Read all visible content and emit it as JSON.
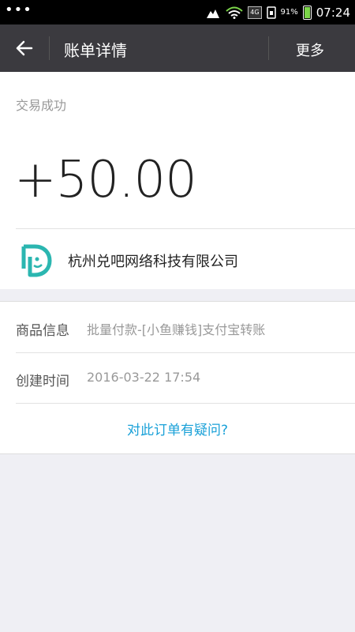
{
  "status_bar": {
    "time": "07:24",
    "battery_pct": "91%",
    "network": "4G"
  },
  "header": {
    "title": "账单详情",
    "more_label": "更多"
  },
  "transaction": {
    "status": "交易成功",
    "amount": "+50.00",
    "merchant": "杭州兑吧网络科技有限公司"
  },
  "details": [
    {
      "label": "商品信息",
      "value": "批量付款-[小鱼赚钱]支付宝转账"
    },
    {
      "label": "创建时间",
      "value": "2016-03-22 17:54"
    }
  ],
  "query_link": "对此订单有疑问?",
  "colors": {
    "header_bg": "#3b3a3f",
    "link": "#1aa1d8",
    "logo": "#2bb6b0"
  }
}
